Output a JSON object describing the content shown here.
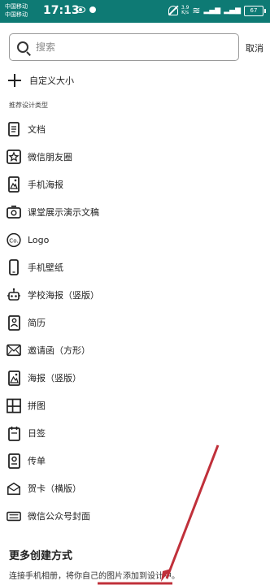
{
  "status_bar": {
    "carrier_1": "中国移动",
    "carrier_2": "中国移动",
    "time": "17:13",
    "network_speed_value": "3.9",
    "network_speed_unit": "K/s",
    "battery": "67"
  },
  "search": {
    "placeholder": "搜索",
    "cancel_label": "取消"
  },
  "custom_size_label": "自定义大小",
  "section_title": "推荐设计类型",
  "design_types": [
    {
      "label": "文档",
      "icon": "document-icon"
    },
    {
      "label": "微信朋友圈",
      "icon": "star-square-icon"
    },
    {
      "label": "手机海报",
      "icon": "phone-poster-icon"
    },
    {
      "label": "课堂展示演示文稿",
      "icon": "presentation-icon"
    },
    {
      "label": "Logo",
      "icon": "logo-circle-icon"
    },
    {
      "label": "手机壁纸",
      "icon": "phone-icon"
    },
    {
      "label": "学校海报（竖版）",
      "icon": "school-poster-icon"
    },
    {
      "label": "简历",
      "icon": "resume-icon"
    },
    {
      "label": "邀请函（方形）",
      "icon": "invitation-icon"
    },
    {
      "label": "海报（竖版）",
      "icon": "poster-icon"
    },
    {
      "label": "拼图",
      "icon": "collage-icon"
    },
    {
      "label": "日签",
      "icon": "daily-card-icon"
    },
    {
      "label": "传单",
      "icon": "flyer-icon"
    },
    {
      "label": "贺卡（横版）",
      "icon": "greeting-card-icon"
    },
    {
      "label": "微信公众号封面",
      "icon": "wechat-cover-icon"
    }
  ],
  "more_options": {
    "title": "更多创建方式",
    "description": "连接手机相册，将你自己的图片添加到设计中。"
  },
  "colors": {
    "status_bar": "#0e7a74",
    "annotation_arrow": "#c0303a"
  }
}
